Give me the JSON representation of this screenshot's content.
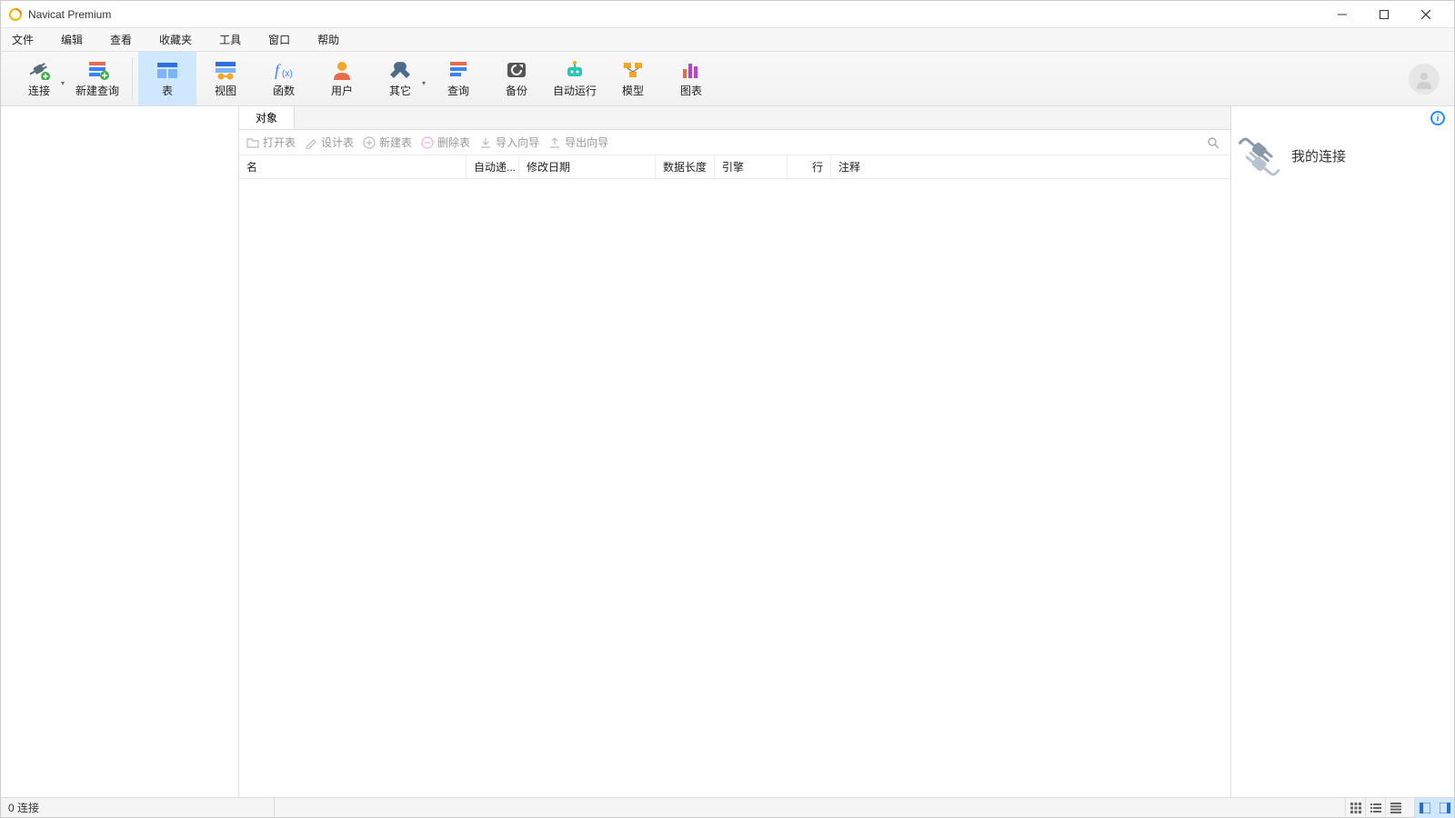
{
  "window": {
    "title": "Navicat Premium"
  },
  "menu": {
    "file": "文件",
    "edit": "编辑",
    "view": "查看",
    "favorites": "收藏夹",
    "tools": "工具",
    "window": "窗口",
    "help": "帮助"
  },
  "toolbar": {
    "connection": "连接",
    "new_query": "新建查询",
    "table": "表",
    "view": "视图",
    "function": "函数",
    "user": "用户",
    "other": "其它",
    "query": "查询",
    "backup": "备份",
    "autorun": "自动运行",
    "model": "模型",
    "chart": "图表"
  },
  "tabs": {
    "objects": "对象"
  },
  "subtoolbar": {
    "open_table": "打开表",
    "design_table": "设计表",
    "new_table": "新建表",
    "delete_table": "删除表",
    "import_wizard": "导入向导",
    "export_wizard": "导出向导"
  },
  "columns": {
    "name": "名",
    "auto_incr": "自动递...",
    "modify_date": "修改日期",
    "data_length": "数据长度",
    "engine": "引擎",
    "rows": "行",
    "comment": "注释"
  },
  "right_panel": {
    "my_connections": "我的连接"
  },
  "status": {
    "connections": "0 连接"
  }
}
